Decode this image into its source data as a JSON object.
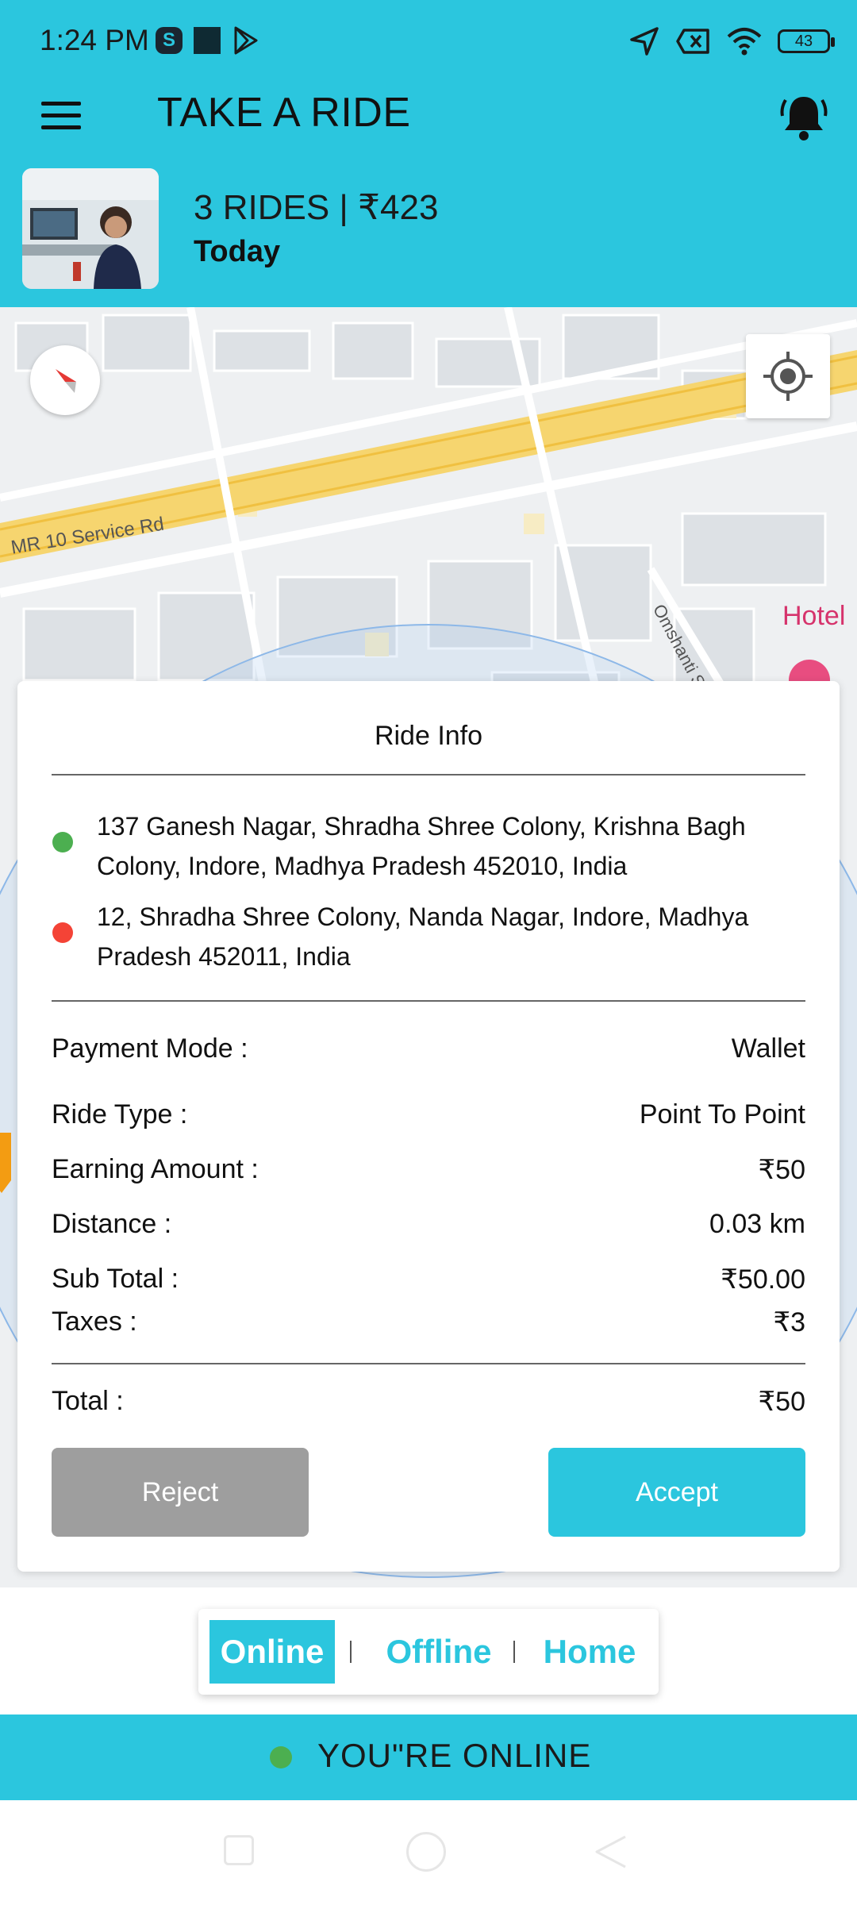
{
  "status_bar": {
    "time": "1:24 PM",
    "battery": "43"
  },
  "header": {
    "title": "TAKE A RIDE",
    "rides_summary": "3 RIDES | ₹423",
    "period": "Today"
  },
  "map": {
    "road_label": "MR 10 Service Rd",
    "street_label": "Omshanti St",
    "poi_label": "Hotel"
  },
  "ride_info": {
    "title": "Ride Info",
    "pickup_address": "137 Ganesh Nagar, Shradha Shree Colony, Krishna Bagh Colony, Indore, Madhya Pradesh 452010, India",
    "drop_address": "12, Shradha Shree Colony, Nanda Nagar, Indore, Madhya Pradesh 452011, India",
    "rows": [
      {
        "label": "Payment Mode :",
        "value": "Wallet"
      },
      {
        "label": "Ride Type :",
        "value": "Point To Point"
      },
      {
        "label": "Earning Amount :",
        "value": "₹50"
      },
      {
        "label": "Distance :",
        "value": "0.03 km"
      },
      {
        "label": "Sub Total :",
        "value": "₹50.00"
      },
      {
        "label": "Taxes :",
        "value": "₹3"
      }
    ],
    "total_label": "Total :",
    "total_value": "₹50",
    "reject_label": "Reject",
    "accept_label": "Accept"
  },
  "mode_switcher": {
    "online": "Online",
    "offline": "Offline",
    "home": "Home"
  },
  "status_banner": "YOU\"RE ONLINE",
  "colors": {
    "primary": "#2BC6DE",
    "reject": "#9e9e9e",
    "pickup_dot": "#4CAF50",
    "drop_dot": "#F44336"
  },
  "icons": [
    "menu-icon",
    "bell-icon",
    "compass-icon",
    "my-location-icon",
    "navigation-arrow-icon",
    "wifi-icon",
    "signal-off-icon",
    "battery-icon"
  ]
}
